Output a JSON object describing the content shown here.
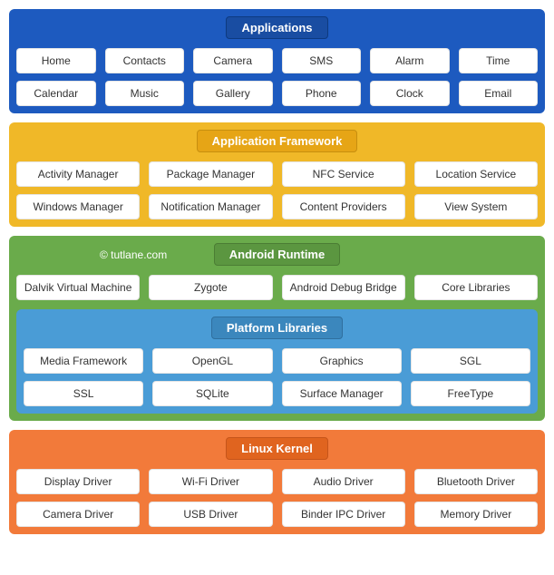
{
  "watermark": "© tutlane.com",
  "layers": {
    "applications": {
      "title": "Applications",
      "row1": [
        "Home",
        "Contacts",
        "Camera",
        "SMS",
        "Alarm",
        "Time"
      ],
      "row2": [
        "Calendar",
        "Music",
        "Gallery",
        "Phone",
        "Clock",
        "Email"
      ]
    },
    "framework": {
      "title": "Application Framework",
      "row1": [
        "Activity Manager",
        "Package Manager",
        "NFC Service",
        "Location Service"
      ],
      "row2": [
        "Windows Manager",
        "Notification Manager",
        "Content Providers",
        "View System"
      ]
    },
    "runtime": {
      "title": "Android Runtime",
      "row1": [
        "Dalvik Virtual Machine",
        "Zygote",
        "Android Debug Bridge",
        "Core Libraries"
      ]
    },
    "platform": {
      "title": "Platform Libraries",
      "row1": [
        "Media Framework",
        "OpenGL",
        "Graphics",
        "SGL"
      ],
      "row2": [
        "SSL",
        "SQLite",
        "Surface Manager",
        "FreeType"
      ]
    },
    "kernel": {
      "title": "Linux Kernel",
      "row1": [
        "Display Driver",
        "Wi-Fi Driver",
        "Audio Driver",
        "Bluetooth Driver"
      ],
      "row2": [
        "Camera Driver",
        "USB Driver",
        "Binder IPC Driver",
        "Memory Driver"
      ]
    }
  }
}
